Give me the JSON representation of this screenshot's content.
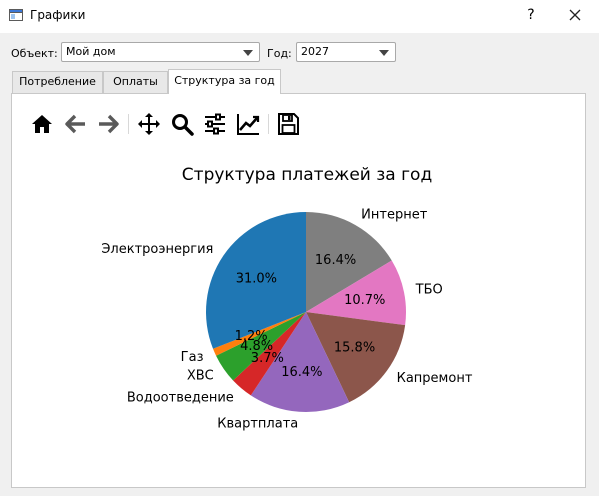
{
  "window": {
    "title": "Графики",
    "help_label": "?"
  },
  "filters": {
    "object_label": "Объект:",
    "object_value": "Мой дом",
    "year_label": "Год:",
    "year_value": "2027"
  },
  "tabs": [
    {
      "label": "Потребление"
    },
    {
      "label": "Оплаты"
    },
    {
      "label": "Структура за год",
      "active": true
    }
  ],
  "toolbar": {
    "icons": [
      "home-icon",
      "back-icon",
      "forward-icon",
      "pan-icon",
      "zoom-icon",
      "configure-subplots-icon",
      "edit-axis-icon",
      "save-icon"
    ]
  },
  "chart_data": {
    "type": "pie",
    "title": "Структура платежей за год",
    "slices": [
      {
        "label": "Интернет",
        "percent": 16.4,
        "pct_label": "16.4%",
        "color": "#7f7f7f"
      },
      {
        "label": "ТБО",
        "percent": 10.7,
        "pct_label": "10.7%",
        "color": "#e377c2"
      },
      {
        "label": "Капремонт",
        "percent": 15.8,
        "pct_label": "15.8%",
        "color": "#8c564b"
      },
      {
        "label": "Квартплата",
        "percent": 16.4,
        "pct_label": "16.4%",
        "color": "#9467bd"
      },
      {
        "label": "Водоотведение",
        "percent": 3.7,
        "pct_label": "3.7%",
        "color": "#d62728"
      },
      {
        "label": "ХВС",
        "percent": 4.8,
        "pct_label": "4.8%",
        "color": "#2ca02c"
      },
      {
        "label": "Газ",
        "percent": 1.2,
        "pct_label": "1.2%",
        "color": "#ff7f0e"
      },
      {
        "label": "Электроэнергия",
        "percent": 31.0,
        "pct_label": "31.0%",
        "color": "#1f77b4"
      }
    ]
  }
}
